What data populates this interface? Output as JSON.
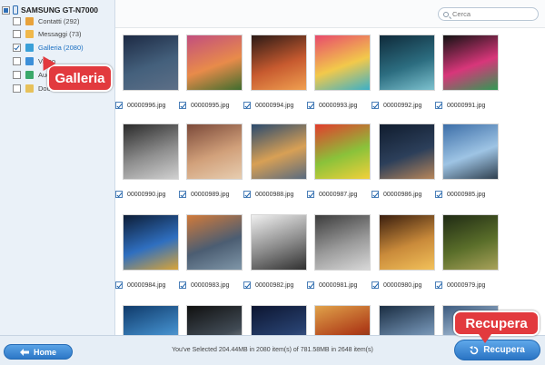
{
  "sidebar": {
    "device_label": "SAMSUNG GT-N7000",
    "items": [
      {
        "label": "Contatti (292)",
        "checked": false,
        "icon": "contacts-icon",
        "color": "#e8a23a"
      },
      {
        "label": "Messaggi (73)",
        "checked": false,
        "icon": "messages-icon",
        "color": "#f0b84a"
      },
      {
        "label": "Galleria (2080)",
        "checked": true,
        "selected": true,
        "icon": "gallery-icon",
        "color": "#3aa0d8"
      },
      {
        "label": "Video",
        "checked": false,
        "icon": "video-icon",
        "color": "#3c8fd8"
      },
      {
        "label": "Audio",
        "checked": false,
        "icon": "audio-icon",
        "color": "#3aa86a"
      },
      {
        "label": "Documenti",
        "checked": false,
        "icon": "documents-icon",
        "color": "#e7c15a"
      }
    ]
  },
  "callouts": {
    "galleria": "Galleria",
    "recupera": "Recupera"
  },
  "search": {
    "placeholder": "Cerca",
    "value": ""
  },
  "grid": {
    "rows": [
      [
        {
          "file": "00000996.jpg",
          "checked": true,
          "colors": [
            "#1d2a44",
            "#44607c",
            "#5d6f87"
          ]
        },
        {
          "file": "00000995.jpg",
          "checked": true,
          "colors": [
            "#c24e7e",
            "#e88b4a",
            "#3e6d2e"
          ]
        },
        {
          "file": "00000994.jpg",
          "checked": true,
          "colors": [
            "#2b1a16",
            "#c75a2f",
            "#f0a050"
          ]
        },
        {
          "file": "00000993.jpg",
          "checked": true,
          "colors": [
            "#e84a6c",
            "#f2c94b",
            "#3ab0c8"
          ]
        },
        {
          "file": "00000992.jpg",
          "checked": true,
          "colors": [
            "#0f2a3a",
            "#2c6d80",
            "#7dc2cf"
          ]
        },
        {
          "file": "00000991.jpg",
          "checked": true,
          "colors": [
            "#121212",
            "#d8367a",
            "#2f9a54"
          ]
        }
      ],
      [
        {
          "file": "00000990.jpg",
          "checked": true,
          "colors": [
            "#2a2a2a",
            "#8e8e8e",
            "#d0d0d0"
          ]
        },
        {
          "file": "00000989.jpg",
          "checked": true,
          "colors": [
            "#7c4a3a",
            "#d1a07a",
            "#e7cdb0"
          ]
        },
        {
          "file": "00000988.jpg",
          "checked": true,
          "colors": [
            "#2a4a6e",
            "#d8a055",
            "#596a7e"
          ]
        },
        {
          "file": "00000987.jpg",
          "checked": true,
          "colors": [
            "#e23d2d",
            "#8ac23a",
            "#f2d03a"
          ]
        },
        {
          "file": "00000986.jpg",
          "checked": true,
          "colors": [
            "#101c2e",
            "#2c3f5a",
            "#b7865a"
          ]
        },
        {
          "file": "00000985.jpg",
          "checked": true,
          "colors": [
            "#3c6ea8",
            "#9ec4e4",
            "#2f3f4e"
          ]
        }
      ],
      [
        {
          "file": "00000984.jpg",
          "checked": true,
          "colors": [
            "#0d1d36",
            "#2f6fc0",
            "#d9a437"
          ]
        },
        {
          "file": "00000983.jpg",
          "checked": true,
          "colors": [
            "#d17a3a",
            "#4b5d72",
            "#7f96a8"
          ]
        },
        {
          "file": "00000982.jpg",
          "checked": true,
          "colors": [
            "#f0f0f0",
            "#8a8a8a",
            "#303030"
          ]
        },
        {
          "file": "00000981.jpg",
          "checked": true,
          "colors": [
            "#3c3c3c",
            "#9a9a9a",
            "#d8d8d8"
          ]
        },
        {
          "file": "00000980.jpg",
          "checked": true,
          "colors": [
            "#3a1e0e",
            "#c98a3a",
            "#f2c15a"
          ]
        },
        {
          "file": "00000979.jpg",
          "checked": true,
          "colors": [
            "#1f2a14",
            "#5a6e2a",
            "#a9a25a"
          ]
        }
      ],
      [
        {
          "file": "",
          "checked": true,
          "colors": [
            "#0f3a6a",
            "#3e86c2",
            "#8fc0e4"
          ]
        },
        {
          "file": "",
          "checked": true,
          "colors": [
            "#101010",
            "#404a54",
            "#c8c8c8"
          ]
        },
        {
          "file": "",
          "checked": true,
          "colors": [
            "#0c1530",
            "#27406e",
            "#6a7fb0"
          ]
        },
        {
          "file": "",
          "checked": true,
          "colors": [
            "#e0a24a",
            "#b0401a",
            "#3a2a20"
          ]
        },
        {
          "file": "",
          "checked": true,
          "colors": [
            "#1a2d42",
            "#6a88a8",
            "#b9cde0"
          ]
        },
        {
          "file": "",
          "checked": true,
          "colors": [
            "#3c5a7e",
            "#a8c0d8",
            "#e8eef4"
          ]
        }
      ]
    ]
  },
  "bottom": {
    "home_label": "Home",
    "status": "You've Selected 204.44MB in 2080 item(s) of 781.58MB in 2648 item(s)",
    "recupera_label": "Recupera"
  }
}
